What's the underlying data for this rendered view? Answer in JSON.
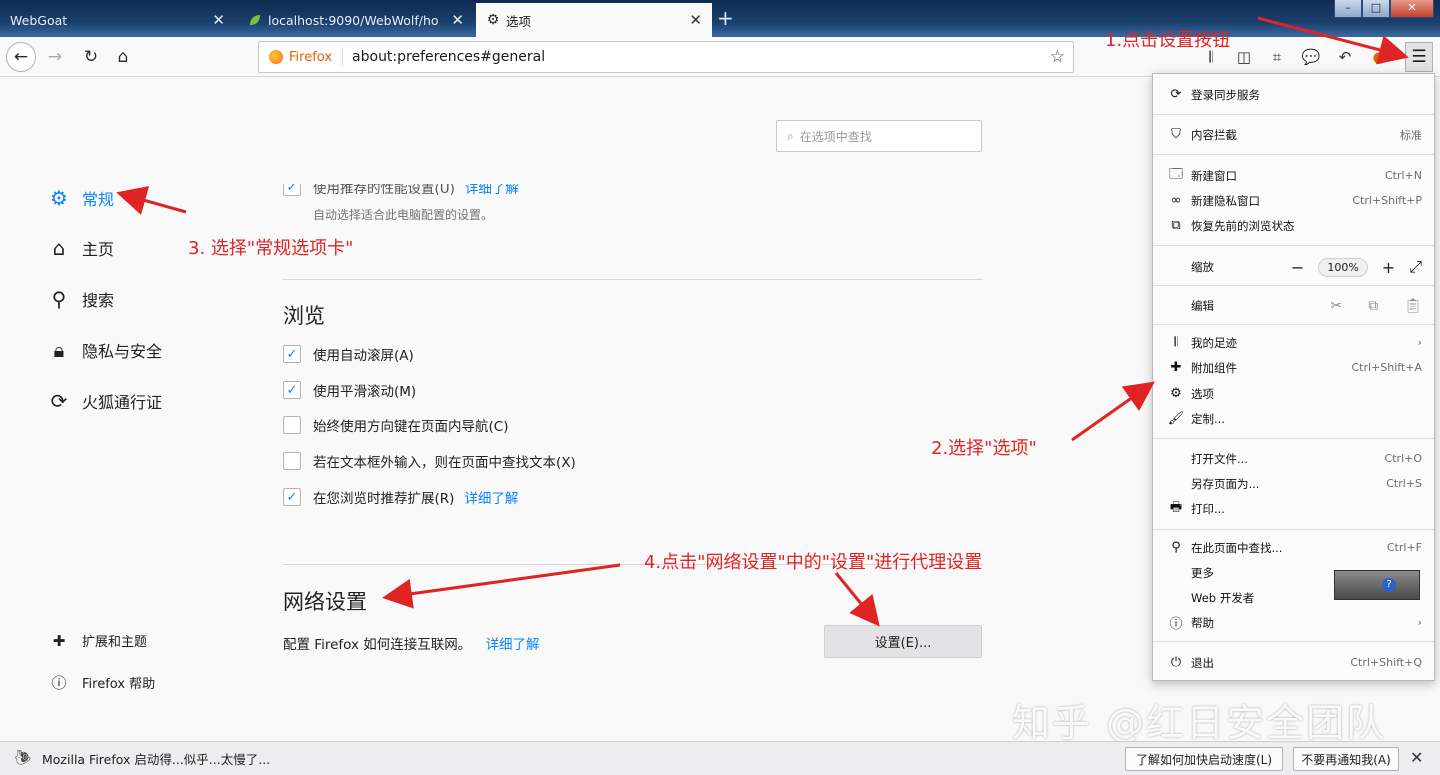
{
  "tabs": [
    {
      "title": "WebGoat",
      "active": false
    },
    {
      "title": "localhost:9090/WebWolf/ho",
      "active": false
    },
    {
      "title": "选项",
      "active": true
    }
  ],
  "navbar": {
    "identity_label": "Firefox",
    "url": "about:preferences#general"
  },
  "prefs": {
    "search_placeholder": "在选项中查找",
    "categories": [
      {
        "label": "常规",
        "icon": "gear-icon",
        "selected": true
      },
      {
        "label": "主页",
        "icon": "home-icon"
      },
      {
        "label": "搜索",
        "icon": "search-icon"
      },
      {
        "label": "隐私与安全",
        "icon": "lock-icon"
      },
      {
        "label": "火狐通行证",
        "icon": "sync-icon"
      }
    ],
    "bottom_links": [
      {
        "label": "扩展和主题",
        "icon": "puzzle-icon"
      },
      {
        "label": "Firefox 帮助",
        "icon": "help-icon"
      }
    ],
    "perf": {
      "checkbox_label": "使用推荐的性能设置(U)",
      "learn_more": "详细了解",
      "description": "自动选择适合此电脑配置的设置。"
    },
    "browsing": {
      "title": "浏览",
      "options": [
        {
          "label": "使用自动滚屏(A)",
          "checked": true
        },
        {
          "label": "使用平滑滚动(M)",
          "checked": true
        },
        {
          "label": "始终使用方向键在页面内导航(C)",
          "checked": false
        },
        {
          "label": "若在文本框外输入，则在页面中查找文本(X)",
          "checked": false
        },
        {
          "label": "在您浏览时推荐扩展(R)",
          "checked": true
        }
      ],
      "learn_more": "详细了解"
    },
    "network": {
      "title": "网络设置",
      "description": "配置 Firefox 如何连接互联网。",
      "learn_more": "详细了解",
      "button": "设置(E)..."
    }
  },
  "app_menu": {
    "sync": "登录同步服务",
    "content_blocking": "内容拦截",
    "content_blocking_status": "标准",
    "new_window": "新建窗口",
    "new_window_shortcut": "Ctrl+N",
    "new_private": "新建隐私窗口",
    "new_private_shortcut": "Ctrl+Shift+P",
    "restore": "恢复先前的浏览状态",
    "zoom_label": "缩放",
    "zoom_minus": "−",
    "zoom_value": "100%",
    "zoom_plus": "+",
    "edit_label": "编辑",
    "library": "我的足迹",
    "addons": "附加组件",
    "addons_shortcut": "Ctrl+Shift+A",
    "options": "选项",
    "customize": "定制...",
    "open_file": "打开文件...",
    "open_file_shortcut": "Ctrl+O",
    "save_page": "另存页面为...",
    "save_page_shortcut": "Ctrl+S",
    "print": "打印...",
    "find": "在此页面中查找...",
    "find_shortcut": "Ctrl+F",
    "more": "更多",
    "web_developer": "Web 开发者",
    "help": "帮助",
    "quit": "退出",
    "quit_shortcut": "Ctrl+Shift+Q"
  },
  "annotations": {
    "step1": "1.点击设置按钮",
    "step2": "2.选择\"选项\"",
    "step3": "3. 选择\"常规选项卡\"",
    "step4": "4.点击\"网络设置\"中的\"设置\"进行代理设置",
    "color": "#e02424"
  },
  "notification": {
    "message": "Mozilla Firefox 启动得...似乎...太慢了...",
    "button1": "了解如何加快启动速度(L)",
    "button2": "不要再通知我(A)"
  },
  "watermark": "知乎 @红日安全团队"
}
